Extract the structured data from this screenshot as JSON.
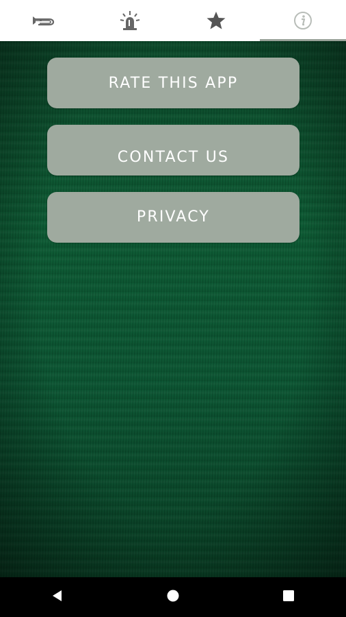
{
  "tabs": [
    {
      "icon": "bugle-icon",
      "active": false
    },
    {
      "icon": "siren-light-icon",
      "active": false
    },
    {
      "icon": "star-icon",
      "active": false
    },
    {
      "icon": "info-icon",
      "active": true
    }
  ],
  "buttons": {
    "rate": "RATE THIS APP",
    "contact": "CONTACT US",
    "privacy": "PRIVACY"
  },
  "colors": {
    "button_bg": "#9faa9f",
    "button_text": "#ffffff",
    "background_green": "#0c5a33",
    "tab_icon": "#666666",
    "tab_icon_active": "#b8bdb8"
  },
  "navbar": [
    "back-icon",
    "home-icon",
    "recents-icon"
  ]
}
